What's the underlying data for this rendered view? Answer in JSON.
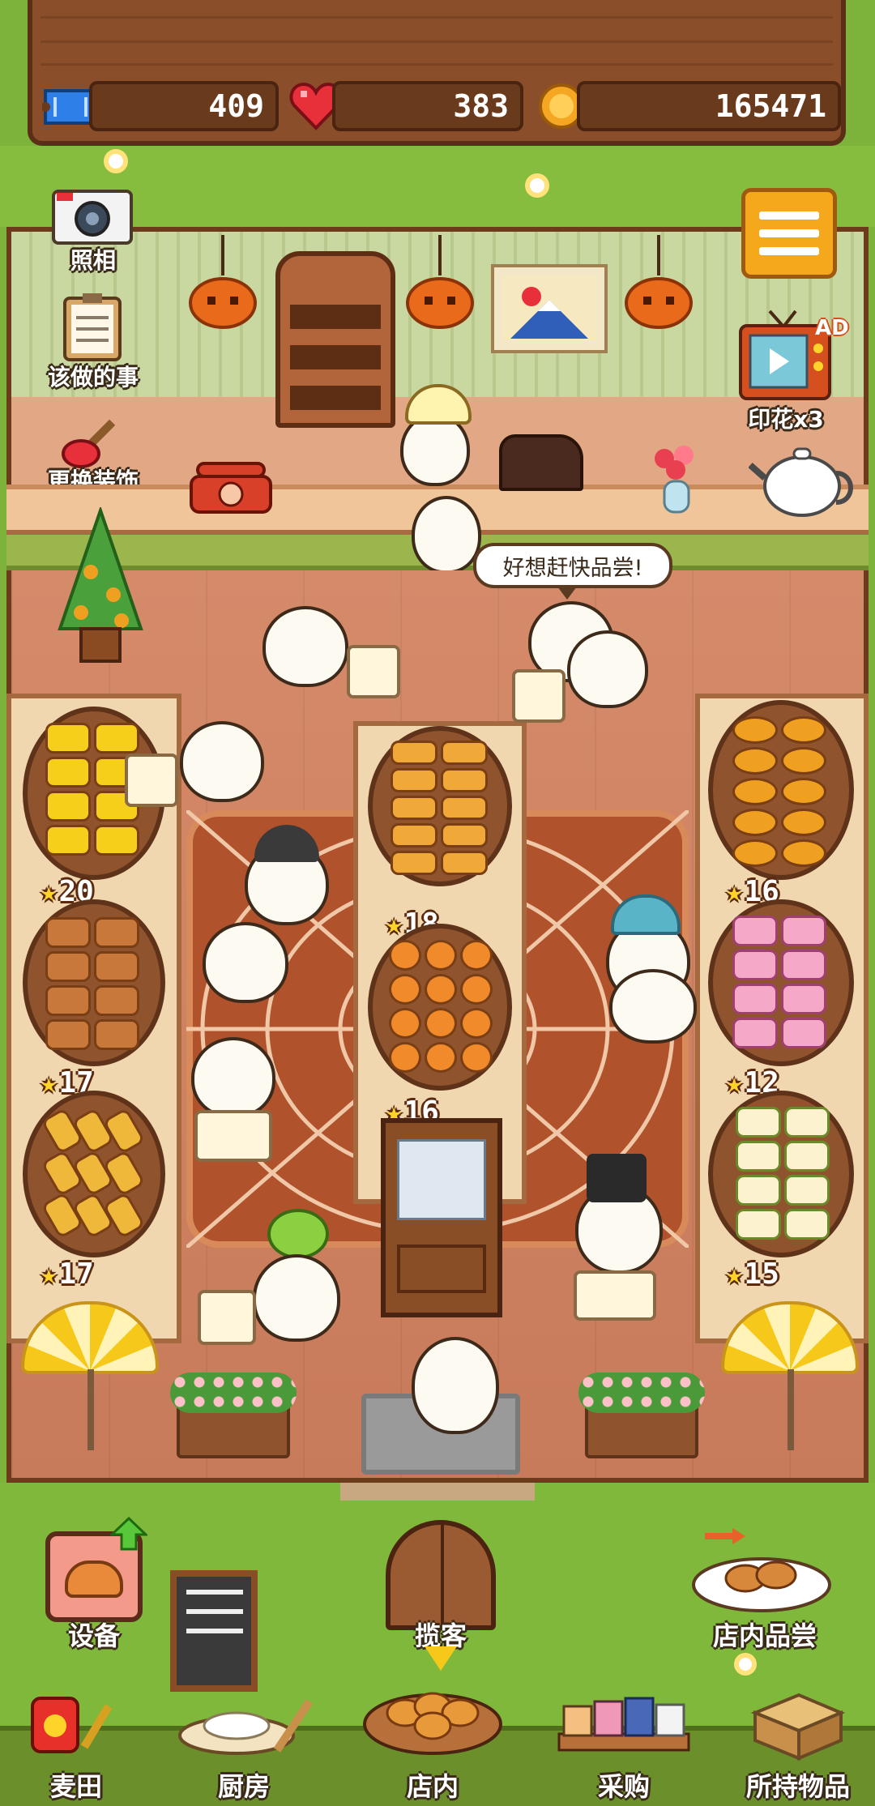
{
  "resources": {
    "tickets": "409",
    "hearts": "383",
    "coins": "165471"
  },
  "colors": {
    "ticket_blue": "#2f7fe8",
    "heart_red": "#e8303a",
    "coin_gold": "#f5a623",
    "menu_orange": "#f6a81c"
  },
  "side_menu": {
    "camera": "照相",
    "todo": "该做的事",
    "decorate": "更换装饰",
    "stamp": "印花x3",
    "ad_badge": "AD"
  },
  "speech_bubble": "好想赶快品尝!",
  "shelves": {
    "left": [
      "20",
      "17",
      "17"
    ],
    "center": [
      "18",
      "16"
    ],
    "right": [
      "16",
      "12",
      "15"
    ]
  },
  "action_buttons": {
    "equipment": "设备",
    "invite": "揽客",
    "tasting": "店内品尝"
  },
  "nav": {
    "field": "麦田",
    "kitchen": "厨房",
    "store": "店内",
    "purchase": "采购",
    "items": "所持物品"
  },
  "icons": {
    "ticket": "ticket-icon",
    "heart": "heart-icon",
    "coin": "coin-icon",
    "menu": "hamburger-menu-icon",
    "camera": "camera-icon",
    "todo": "clipboard-icon",
    "decorate": "paintbrush-icon",
    "tv": "tv-ad-icon",
    "upgrade": "green-up-arrow-icon"
  }
}
